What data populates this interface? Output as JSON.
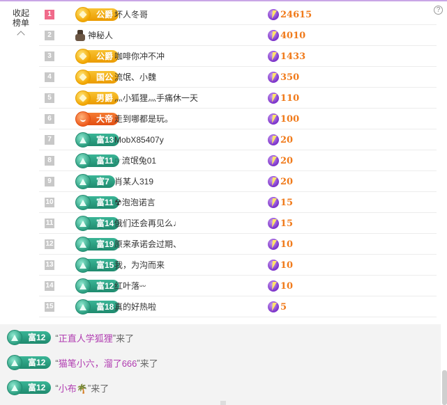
{
  "collapse": {
    "line1": "收起",
    "line2": "榜单"
  },
  "help_symbol": "?",
  "ranking": [
    {
      "rank": "1",
      "badge": "公爵",
      "badge_style": "gold",
      "name": "坏人冬哥",
      "score": "24615"
    },
    {
      "rank": "2",
      "badge": "",
      "badge_style": "mystery",
      "name": "神秘人",
      "score": "4010"
    },
    {
      "rank": "3",
      "badge": "公爵",
      "badge_style": "gold",
      "name": "咖啡你冲不冲",
      "score": "1433"
    },
    {
      "rank": "4",
      "badge": "国公",
      "badge_style": "gold",
      "name": "流氓、小魏",
      "score": "350"
    },
    {
      "rank": "5",
      "badge": "男爵",
      "badge_style": "gold",
      "name": "灬小狐狸灬手痛休一天",
      "score": "110"
    },
    {
      "rank": "6",
      "badge": "大帝",
      "badge_style": "orange",
      "name": "走到哪都是玩。",
      "score": "100"
    },
    {
      "rank": "7",
      "badge": "富13",
      "badge_style": "teal",
      "name": "MobX85407y",
      "score": "20"
    },
    {
      "rank": "8",
      "badge": "富11",
      "badge_style": "teal",
      "name": "☞流氓兔01",
      "score": "20"
    },
    {
      "rank": "9",
      "badge": "富7",
      "badge_style": "teal",
      "name": "肖某人319",
      "score": "20"
    },
    {
      "rank": "10",
      "badge": "富11",
      "badge_style": "teal",
      "name": "☢泡泡诺言",
      "score": "15"
    },
    {
      "rank": "11",
      "badge": "富14",
      "badge_style": "teal",
      "name": "俄们还会再见么♩",
      "score": "15"
    },
    {
      "rank": "12",
      "badge": "富19",
      "badge_style": "teal",
      "name": "原来承诺会过期、",
      "score": "10"
    },
    {
      "rank": "13",
      "badge": "富15",
      "badge_style": "teal",
      "name": "我，为沟而来",
      "score": "10"
    },
    {
      "rank": "14",
      "badge": "富12",
      "badge_style": "teal",
      "name": "红叶落ᵕᵕ",
      "score": "10"
    },
    {
      "rank": "15",
      "badge": "富18",
      "badge_style": "teal",
      "name": "真的好热啦",
      "score": "5"
    }
  ],
  "feed": [
    {
      "badge": "富12",
      "open_quote": "“",
      "name": "正直人学狐狸",
      "close_quote": "”",
      "suffix": "来了"
    },
    {
      "badge": "富12",
      "open_quote": "“",
      "name": "猫笔小六，溜了666",
      "close_quote": "”",
      "suffix": "来了"
    },
    {
      "badge": "富12",
      "open_quote": "“",
      "name": "小布🌴",
      "close_quote": "”",
      "suffix": "来了"
    }
  ]
}
